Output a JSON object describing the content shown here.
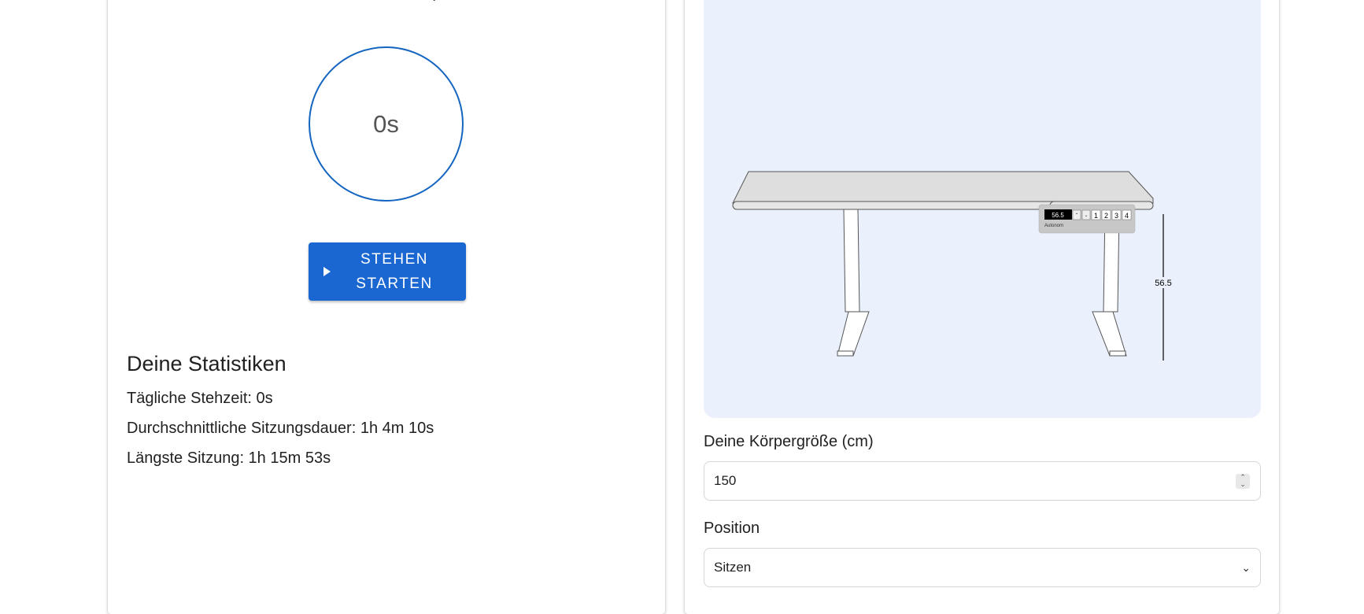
{
  "timer": {
    "value": "0s"
  },
  "start_button": {
    "label_line1": "STEHEN",
    "label_line2": "STARTEN"
  },
  "stats": {
    "title": "Deine Statistiken",
    "daily": "Tägliche Stehzeit: 0s",
    "average": "Durchschnittliche Sitzungsdauer: 1h 4m 10s",
    "longest": "Längste Sitzung: 1h 15m 53s"
  },
  "desk": {
    "display_value": "56.5",
    "brand": "Autonom",
    "preset_buttons": [
      "1",
      "2",
      "3",
      "4"
    ],
    "height_label": "56.5"
  },
  "form": {
    "height_label": "Deine Körpergröße (cm)",
    "height_value": "150",
    "position_label": "Position",
    "position_value": "Sitzen"
  },
  "colors": {
    "accent": "#1a67d2",
    "panel_bg": "#eaf1fd",
    "ring": "#1565c0"
  }
}
